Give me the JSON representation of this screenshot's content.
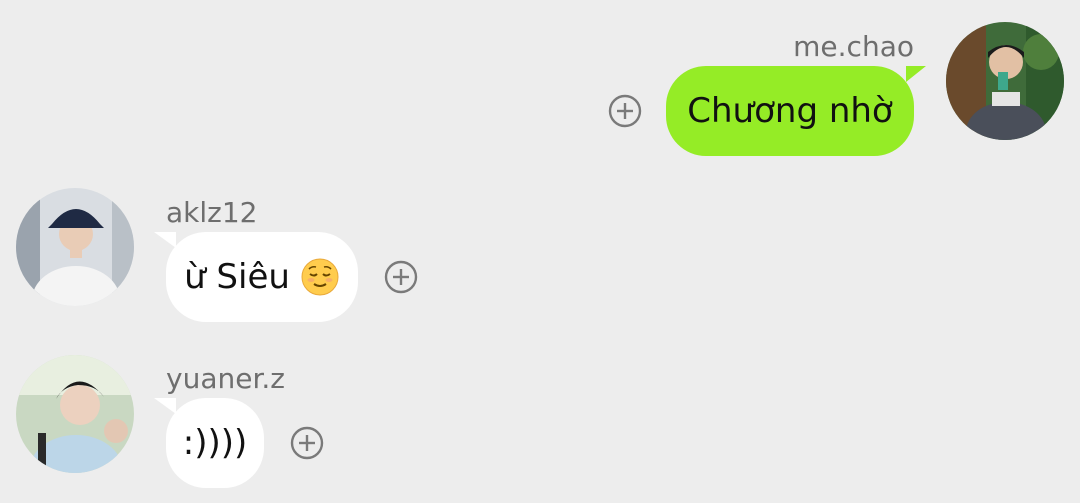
{
  "messages": [
    {
      "sender": "me.chao",
      "text": "Chương nhờ",
      "side": "right",
      "bubble_color": "#95ec26"
    },
    {
      "sender": "aklz12",
      "text": "ừ Siêu",
      "emoji": "relieved-face-emoji",
      "side": "left",
      "bubble_color": "#ffffff"
    },
    {
      "sender": "yuaner.z",
      "text": ":))))",
      "side": "left",
      "bubble_color": "#ffffff"
    }
  ],
  "icons": {
    "react": "add-reaction-icon"
  },
  "colors": {
    "background": "#ededed",
    "my_bubble": "#95ec26",
    "other_bubble": "#ffffff",
    "username": "#6e6e6e"
  }
}
